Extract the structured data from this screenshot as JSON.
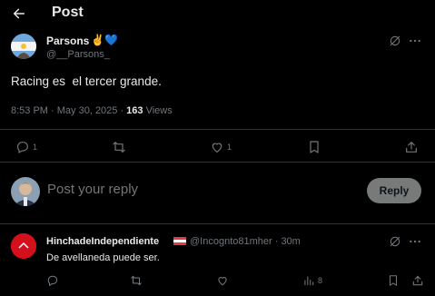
{
  "header": {
    "title": "Post"
  },
  "tweet": {
    "author_name": "Parsons",
    "author_emoji": "✌️💙",
    "author_handle": "@__Parsons_",
    "text": "Racing es  el tercer grande.",
    "time": "8:53 PM · May 30, 2025 · ",
    "views_count": "163",
    "views_label": " Views",
    "replies": "1",
    "likes": "1"
  },
  "composer": {
    "placeholder": "Post your reply",
    "button_label": "Reply"
  },
  "reply": {
    "author_name": "HinchadeIndependiente",
    "handle_time": "@Incognto81mher · 30m",
    "text": "De avellaneda puede ser.",
    "replies": "",
    "likes": "",
    "views": "8"
  },
  "icons": [
    "back-arrow-icon",
    "grok-icon",
    "more-icon",
    "reply-icon",
    "repost-icon",
    "like-icon",
    "bookmark-icon",
    "share-icon",
    "views-icon",
    "flag-icon"
  ],
  "colors": {
    "background": "#000000",
    "text": "#e7e9ea",
    "muted": "#71767b",
    "divider": "#2f3336",
    "reply_button": "#787a7a"
  }
}
